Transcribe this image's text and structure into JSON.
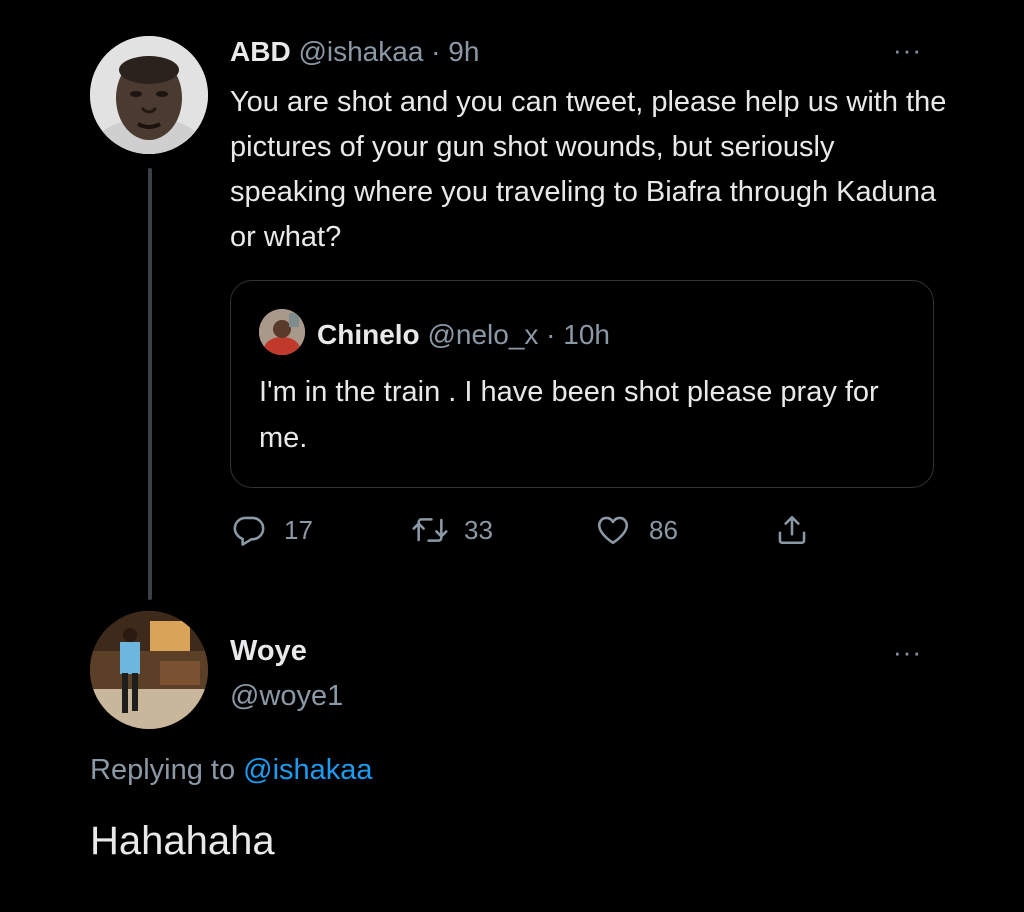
{
  "tweet": {
    "author": {
      "name": "ABD",
      "handle": "@ishakaa",
      "separator": " · ",
      "time": "9h"
    },
    "text": "You are shot and you can tweet, please help us with the pictures of your gun shot wounds, but seriously speaking where you traveling to Biafra through Kaduna or what?",
    "more_label": "···",
    "quoted": {
      "name": "Chinelo",
      "handle": "@nelo_x",
      "separator": " · ",
      "time": "10h",
      "text": "I'm in the train .  I have been shot please pray for me."
    },
    "actions": {
      "reply_count": "17",
      "retweet_count": "33",
      "like_count": "86"
    }
  },
  "reply": {
    "name": "Woye",
    "handle": "@woye1",
    "more_label": "···",
    "replying_prefix": "Replying to ",
    "replying_handle": "@ishakaa",
    "text": "Hahahaha"
  },
  "colors": {
    "background": "#000000",
    "text": "#e7e9ea",
    "muted": "#8b98a5",
    "link": "#1d9bf0",
    "border": "#2f3336"
  },
  "icons": [
    "reply-icon",
    "retweet-icon",
    "like-icon",
    "share-icon",
    "more-options-icon"
  ]
}
